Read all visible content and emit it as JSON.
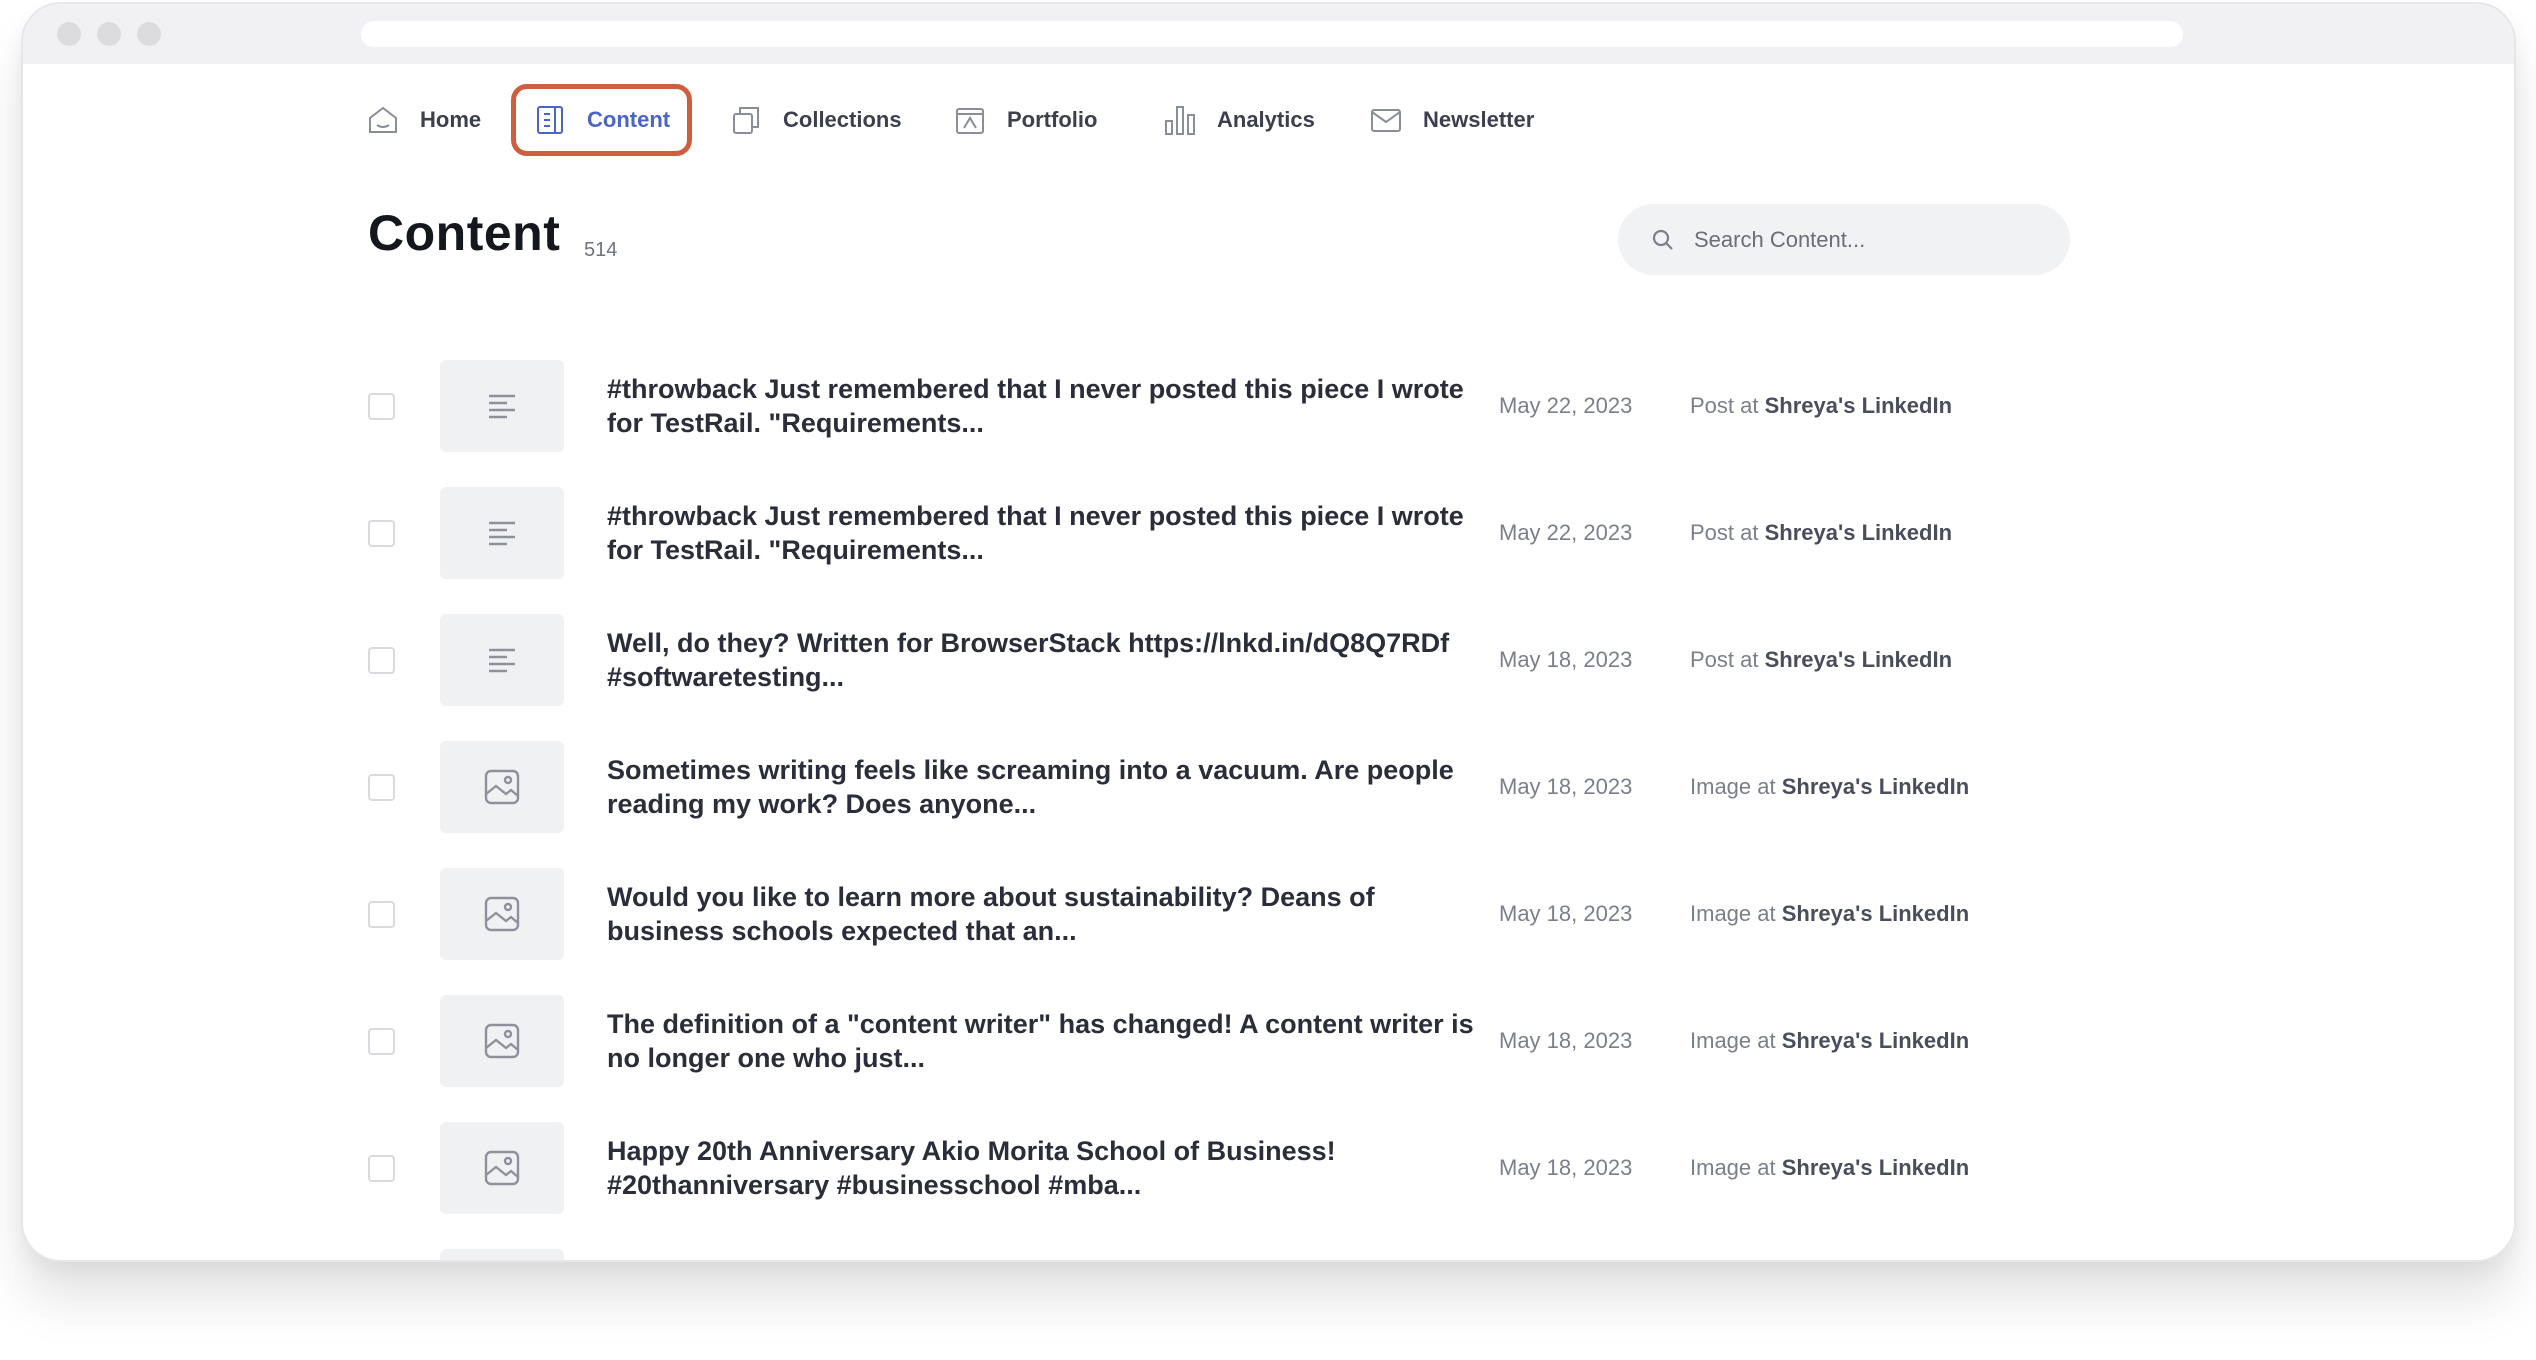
{
  "nav": {
    "items": [
      {
        "label": "Home",
        "icon": "home-icon"
      },
      {
        "label": "Content",
        "icon": "document-icon",
        "active": true
      },
      {
        "label": "Collections",
        "icon": "collections-icon"
      },
      {
        "label": "Portfolio",
        "icon": "portfolio-icon"
      },
      {
        "label": "Analytics",
        "icon": "bar-chart-icon"
      },
      {
        "label": "Newsletter",
        "icon": "mail-icon"
      }
    ]
  },
  "page": {
    "title": "Content",
    "count": "514"
  },
  "search": {
    "placeholder": "Search Content..."
  },
  "colors": {
    "active_nav": "#4a64c8",
    "highlight_border": "#cf5d3f"
  },
  "rows": [
    {
      "type": "text-icon",
      "title": "#throwback Just remembered that I never posted this piece I wrote for TestRail. \"Requirements...",
      "date": "May 22, 2023",
      "kind": "Post at",
      "source": "Shreya's LinkedIn"
    },
    {
      "type": "text-icon",
      "title": "#throwback Just remembered that I never posted this piece I wrote for TestRail. \"Requirements...",
      "date": "May 22, 2023",
      "kind": "Post at",
      "source": "Shreya's LinkedIn"
    },
    {
      "type": "text-icon",
      "title": "Well, do they? Written for BrowserStack https://lnkd.in/dQ8Q7RDf #softwaretesting...",
      "date": "May 18, 2023",
      "kind": "Post at",
      "source": "Shreya's LinkedIn"
    },
    {
      "type": "image-icon",
      "title": "Sometimes writing feels like screaming into a vacuum. Are people reading my work? Does anyone...",
      "date": "May 18, 2023",
      "kind": "Image at",
      "source": "Shreya's LinkedIn"
    },
    {
      "type": "image-icon",
      "title": "Would you like to learn more about sustainability? Deans of business schools expected that an...",
      "date": "May 18, 2023",
      "kind": "Image at",
      "source": "Shreya's LinkedIn"
    },
    {
      "type": "image-icon",
      "title": "The definition of a \"content writer\" has changed! A content writer is no longer one who just...",
      "date": "May 18, 2023",
      "kind": "Image at",
      "source": "Shreya's LinkedIn"
    },
    {
      "type": "image-icon",
      "title": "Happy 20th Anniversary Akio Morita School of Business! #20thanniversary #businesschool #mba...",
      "date": "May 18, 2023",
      "kind": "Image at",
      "source": "Shreya's LinkedIn"
    }
  ]
}
